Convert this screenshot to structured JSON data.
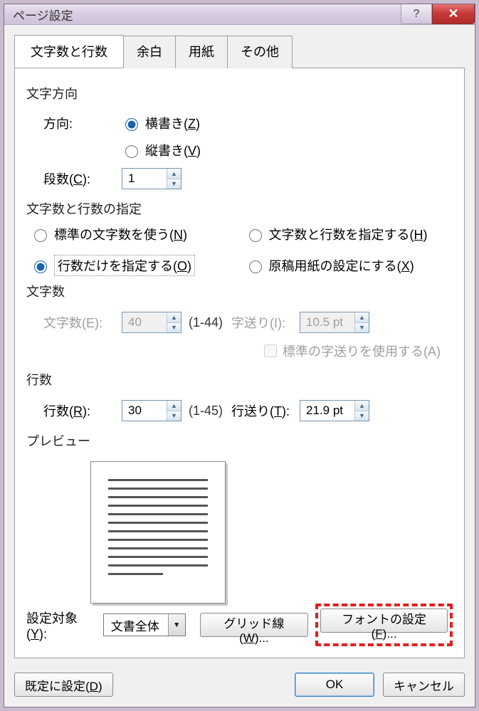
{
  "title": "ページ設定",
  "tabs": {
    "t0": "文字数と行数",
    "t1": "余白",
    "t2": "用紙",
    "t3": "その他"
  },
  "sec": {
    "direction": "文字方向",
    "dir_label": "方向:",
    "yoko": "横書き(",
    "yoko_key": "Z",
    "tate": "縦書き(",
    "tate_key": "V",
    "dansu_label": "段数(",
    "dansu_key": "C",
    "dansu_val": "1",
    "spec": "文字数と行数の指定",
    "opt1a": "標準の文字数を使う(",
    "opt1k": "N",
    "opt2a": "文字数と行数を指定する(",
    "opt2k": "H",
    "opt3a": "行数だけを指定する(",
    "opt3k": "O",
    "opt4a": "原稿用紙の設定にする(",
    "opt4k": "X",
    "chars": "文字数",
    "chars_label": "文字数(E):",
    "chars_val": "40",
    "chars_range": "(1-44)",
    "pitch_label": "字送り(I):",
    "pitch_val": "10.5 pt",
    "std_pitch": "標準の字送りを使用する(A)",
    "lines": "行数",
    "lines_label": "行数(",
    "lines_key": "R",
    "lines_val": "30",
    "lines_range": "(1-45)",
    "lpitch_label": "行送り(",
    "lpitch_key": "T",
    "lpitch_val": "21.9 pt",
    "preview": "プレビュー",
    "apply_label": "設定対象(",
    "apply_key": "Y",
    "apply_val": "文書全体",
    "grid_btn_a": "グリッド線(",
    "grid_btn_k": "W",
    "grid_btn_b": ")...",
    "font_btn_a": "フォントの設定(",
    "font_btn_k": "F",
    "font_btn_b": ")..."
  },
  "footer": {
    "default_a": "既定に設定(",
    "default_k": "D",
    "ok": "OK",
    "cancel": "キャンセル"
  }
}
